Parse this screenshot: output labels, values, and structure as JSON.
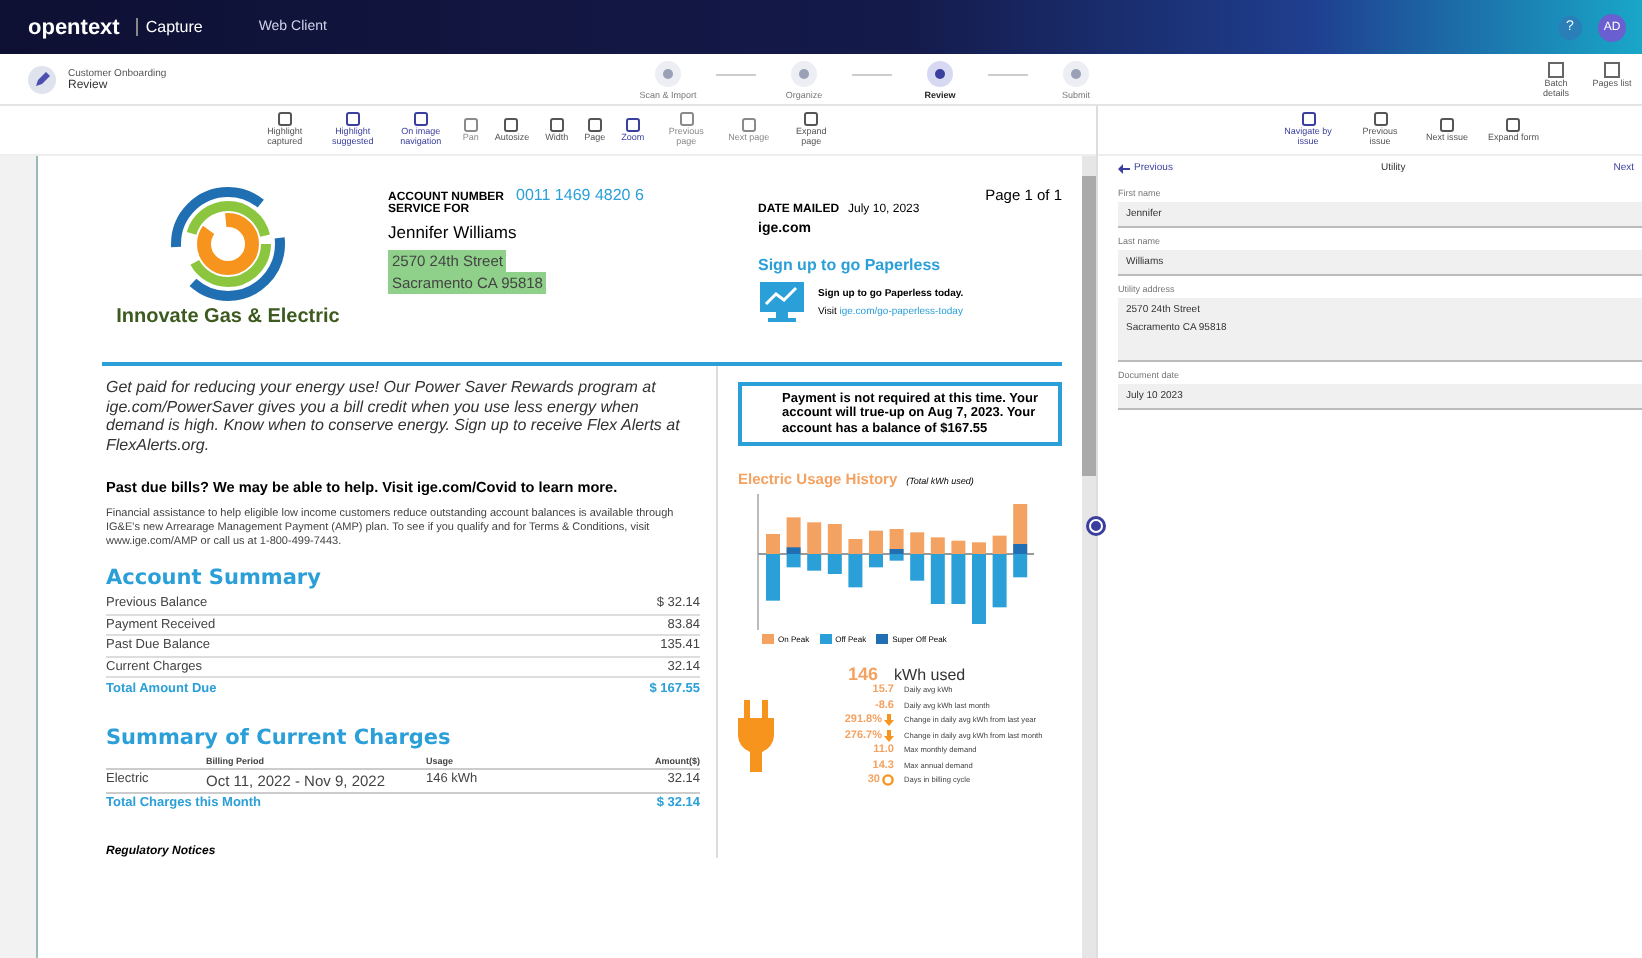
{
  "app_bar": {
    "brand": "opentext",
    "product": "Capture",
    "section": "Web Client",
    "help": "?",
    "avatar": "AD"
  },
  "header": {
    "workflow": "Customer Onboarding",
    "stage": "Review",
    "steps": [
      {
        "label": "Scan & Import",
        "selected": false
      },
      {
        "label": "Organize",
        "selected": false
      },
      {
        "label": "Review",
        "selected": true
      },
      {
        "label": "Submit",
        "selected": false
      }
    ],
    "actions": [
      "Batch details",
      "Pages list"
    ]
  },
  "viewer_tools": [
    {
      "label": "Highlight captured",
      "selected": false,
      "disabled": false
    },
    {
      "label": "Highlight suggested",
      "selected": true,
      "disabled": false
    },
    {
      "label": "On image navigation",
      "selected": true,
      "disabled": false
    },
    {
      "label": "Pan",
      "selected": false,
      "disabled": true
    },
    {
      "label": "Autosize",
      "selected": false,
      "disabled": false
    },
    {
      "label": "Width",
      "selected": false,
      "disabled": false
    },
    {
      "label": "Page",
      "selected": false,
      "disabled": false
    },
    {
      "label": "Zoom",
      "selected": true,
      "disabled": false
    },
    {
      "label": "Previous page",
      "selected": false,
      "disabled": true
    },
    {
      "label": "Next page",
      "selected": false,
      "disabled": true
    },
    {
      "label": "Expand page",
      "selected": false,
      "disabled": false
    }
  ],
  "form_tools": [
    {
      "label": "Navigate by issue",
      "selected": true,
      "disabled": false
    },
    {
      "label": "Previous issue",
      "selected": false,
      "disabled": false
    },
    {
      "label": "Next issue",
      "selected": false,
      "disabled": false
    },
    {
      "label": "Expand form",
      "selected": false,
      "disabled": false
    }
  ],
  "bill": {
    "company": "Innovate Gas & Electric",
    "account_label": "ACCOUNT NUMBER",
    "account_number": "0011 1469 4820 6",
    "service_label": "SERVICE FOR",
    "customer": "Jennifer Williams",
    "address_lines": [
      "2570 24th Street",
      "Sacramento CA 95818"
    ],
    "address_highlighted": true,
    "date_label": "DATE MAILED",
    "date": "July 10, 2023",
    "website": "ige.com",
    "page": "Page 1 of 1",
    "paperless_title": "Sign up to go Paperless",
    "paperless_text": "Sign up to go Paperless today.",
    "visit": "Visit",
    "paperless_link": "ige.com/go-paperless-today",
    "promo": "Get paid for reducing your energy use! Our Power Saver Rewards program at ige.com/PowerSaver gives you a bill credit when you use less energy when demand is high. Know when to conserve energy. Sign up to receive Flex Alerts at FlexAlerts.org.",
    "past_due_title": "Past due bills? We may be able to help. Visit ige.com/Covid to learn more.",
    "assistance": "Financial assistance to help eligible low income customers reduce outstanding account balances is available through IG&E's new Arrearage Management Payment (AMP) plan. To see if you qualify and for Terms & Conditions, visit www.ige.com/AMP or call us at 1-800-499-7443.",
    "summary_title": "Account Summary",
    "summary_rows": [
      {
        "label": "Previous Balance",
        "amount": "$  32.14",
        "kind": "line"
      },
      {
        "label": "Payment Received",
        "amount": "83.84",
        "kind": "line"
      },
      {
        "label": "Past Due Balance",
        "amount": "135.41",
        "kind": "line"
      },
      {
        "label": "Current Charges",
        "amount": "32.14",
        "kind": "line"
      },
      {
        "label": "Total Amount Due",
        "amount": "$ 167.55",
        "kind": "total"
      }
    ],
    "charges_title": "Summary of Current Charges",
    "charges_columns": [
      "Billing Period",
      "Usage",
      "Amount($)"
    ],
    "charges_rows": [
      {
        "service": "Electric",
        "period": "Oct 11, 2022 - Nov 9, 2022",
        "usage": "146 kWh",
        "amount": "32.14"
      }
    ],
    "charges_total": {
      "label": "Total Charges this Month",
      "amount": "$  32.14"
    },
    "notices_title": "Regulatory Notices",
    "payment_notice": "Payment is not required at this time. Your account will true-up on Aug 7, 2023. Your account has a balance of $167.55",
    "usage_title": "Electric Usage History",
    "usage_subtitle": "(Total kWh used)",
    "legend": [
      {
        "label": "On Peak",
        "color": "#f4a261"
      },
      {
        "label": "Off Peak",
        "color": "#2a9fd8"
      },
      {
        "label": "Super Off Peak",
        "color": "#1f6fb2"
      }
    ],
    "kwh": "146",
    "kwh_label": "kWh used",
    "stats": [
      {
        "value": "15.7",
        "label": "Daily avg kWh",
        "kind": "plain"
      },
      {
        "value": "-8.6",
        "label": "Daily avg kWh last month",
        "kind": "plain"
      },
      {
        "value": "291.8%",
        "label": "Change in daily avg kWh from last year",
        "kind": "down"
      },
      {
        "value": "276.7%",
        "label": "Change in daily avg kWh from last month",
        "kind": "down"
      },
      {
        "value": "11.0",
        "label": "Max monthly demand",
        "kind": "plain"
      },
      {
        "value": "14.3",
        "label": "Max annual demand",
        "kind": "plain"
      },
      {
        "value": "30",
        "label": "Days in billing cycle",
        "kind": "cycle"
      }
    ]
  },
  "form": {
    "previous": "Previous",
    "title": "Utility",
    "next": "Next",
    "fields": [
      {
        "label": "First name",
        "lines": [
          "Jennifer"
        ]
      },
      {
        "label": "Last name",
        "lines": [
          "Williams"
        ]
      },
      {
        "label": "Utility address",
        "lines": [
          "2570 24th Street",
          "Sacramento CA 95818"
        ]
      },
      {
        "label": "Document date",
        "lines": [
          "July 10 2023"
        ]
      }
    ]
  }
}
